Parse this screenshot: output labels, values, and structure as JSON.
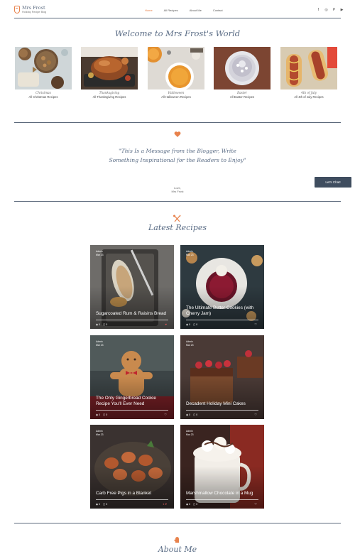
{
  "brand": {
    "name": "Mrs Frost",
    "tagline": "Holiday Recipe Blog"
  },
  "nav": {
    "items": [
      {
        "label": "Home",
        "active": true
      },
      {
        "label": "All Recipes",
        "active": false
      },
      {
        "label": "About Me",
        "active": false
      },
      {
        "label": "Contact",
        "active": false
      }
    ]
  },
  "social": {
    "icons": [
      "facebook-icon",
      "instagram-icon",
      "pinterest-icon",
      "youtube-icon"
    ]
  },
  "welcome": {
    "title": "Welcome to Mrs Frost's World",
    "categories": [
      {
        "name": "Christmas",
        "link": "All Christmas Recipes"
      },
      {
        "name": "Thanksgiving",
        "link": "All Thanksgiving Recipes"
      },
      {
        "name": "Halloween",
        "link": "All Halloween Recipes"
      },
      {
        "name": "Easter",
        "link": "All Easter Recipes"
      },
      {
        "name": "4th of July",
        "link": "All 4th of July Recipes"
      }
    ]
  },
  "message": {
    "quote": "\"This Is a Message from the Blogger, Write Something Inspirational for the Readers to Enjoy\"",
    "signature_line1": "Love,",
    "signature_line2": "Mrs Frost"
  },
  "chat": {
    "label": "Let's Chat!"
  },
  "latest": {
    "title": "Latest Recipes",
    "cards": [
      {
        "author": "Admin",
        "date": "Mar 23",
        "read": "1 min",
        "title": "Sugarcoated Rum & Raisins Bread",
        "views": "0",
        "comments": "0",
        "like": "0"
      },
      {
        "author": "Admin",
        "date": "Mar 23",
        "read": "1 min",
        "title": "The Ultimate Butter Cookies (with Cherry Jam)",
        "views": "0",
        "comments": "0",
        "like": "0"
      },
      {
        "author": "Admin",
        "date": "Mar 23",
        "read": "1 min",
        "title": "The Only Gingerbread Cookie Recipe You'll Ever Need",
        "views": "0",
        "comments": "0",
        "like": "0"
      },
      {
        "author": "Admin",
        "date": "Mar 23",
        "read": "1 min",
        "title": "Decadent Holiday Mini Cakes",
        "views": "0",
        "comments": "0",
        "like": "0"
      },
      {
        "author": "Admin",
        "date": "Mar 23",
        "read": "1 min",
        "title": "Carb Free Pigs in a Blanket",
        "views": "0",
        "comments": "0",
        "like": "1"
      },
      {
        "author": "Admin",
        "date": "Mar 23",
        "read": "1 min",
        "title": "Marshmallow Chocolate in a Mug",
        "views": "0",
        "comments": "0",
        "like": "0"
      }
    ]
  },
  "about": {
    "title": "About Me"
  },
  "colors": {
    "accent": "#e8824c",
    "heading": "#5a6c85",
    "rule": "#5c6a7c",
    "chat_bg": "#3f4d5f"
  }
}
